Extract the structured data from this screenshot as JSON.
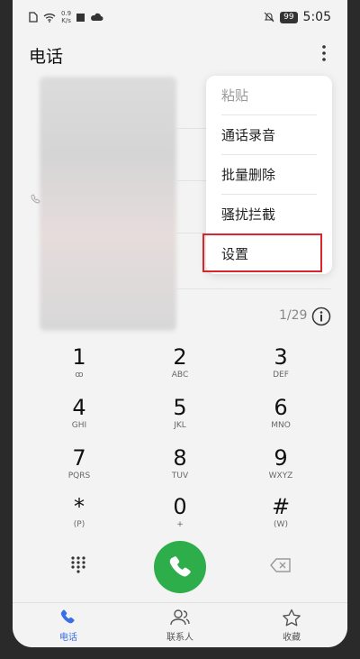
{
  "status_bar": {
    "net_speed_value": "0.9",
    "net_speed_unit": "K/s",
    "battery": "99",
    "time": "5:05"
  },
  "header": {
    "title": "电话"
  },
  "menu": {
    "items": [
      {
        "label": "粘贴"
      },
      {
        "label": "通话录音"
      },
      {
        "label": "批量删除"
      },
      {
        "label": "骚扰拦截"
      },
      {
        "label": "设置"
      }
    ],
    "highlight_color": "#d9252c"
  },
  "list": {
    "count": "1/29"
  },
  "keypad": {
    "keys": [
      {
        "digit": "1",
        "letters": "ꝏ"
      },
      {
        "digit": "2",
        "letters": "ABC"
      },
      {
        "digit": "3",
        "letters": "DEF"
      },
      {
        "digit": "4",
        "letters": "GHI"
      },
      {
        "digit": "5",
        "letters": "JKL"
      },
      {
        "digit": "6",
        "letters": "MNO"
      },
      {
        "digit": "7",
        "letters": "PQRS"
      },
      {
        "digit": "8",
        "letters": "TUV"
      },
      {
        "digit": "9",
        "letters": "WXYZ"
      },
      {
        "digit": "*",
        "letters": "(P)"
      },
      {
        "digit": "0",
        "letters": "+"
      },
      {
        "digit": "#",
        "letters": "(W)"
      }
    ]
  },
  "bottom_nav": {
    "items": [
      {
        "label": "电话",
        "icon": "phone-icon"
      },
      {
        "label": "联系人",
        "icon": "contacts-icon"
      },
      {
        "label": "收藏",
        "icon": "star-icon"
      }
    ],
    "active_color": "#3a6ee8"
  },
  "colors": {
    "call_button": "#2eae4a"
  }
}
